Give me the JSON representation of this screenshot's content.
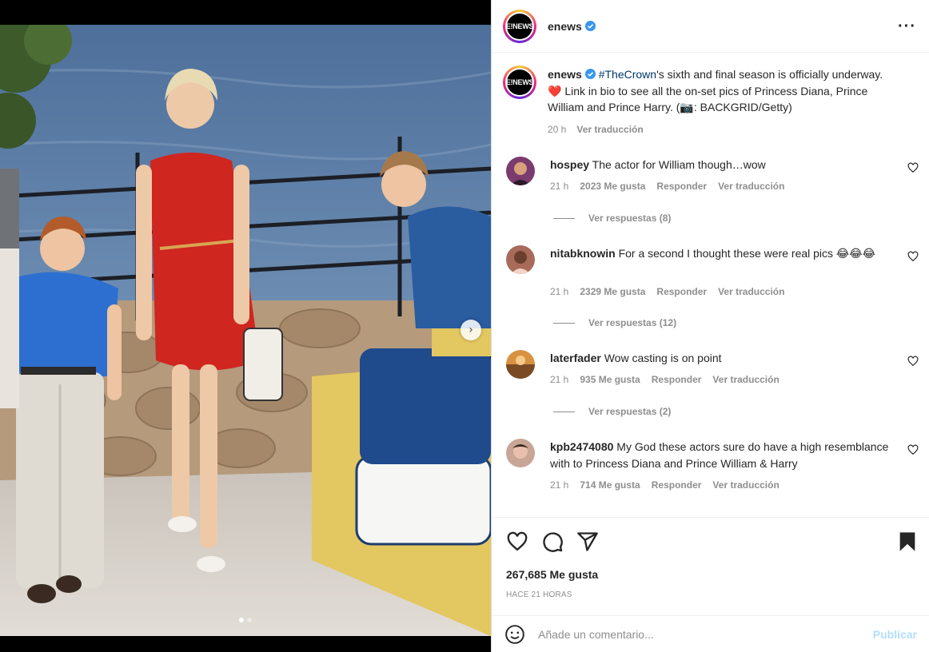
{
  "post": {
    "account": "enews",
    "avatar_text": "E!NEWS",
    "caption_hashtag": "#TheCrown",
    "caption_text": "'s sixth and final season is officially underway. ❤️ Link in bio to see all the on-set pics of Princess Diana, Prince William and Prince Harry. (📷: BACKGRID/Getty)",
    "caption_time": "20 h",
    "caption_translate": "Ver traducción",
    "more_icon": "more-horizontal-icon"
  },
  "comments": [
    {
      "user": "hospey",
      "text": "The actor for William though…wow",
      "time": "21 h",
      "likes": "2023 Me gusta",
      "reply": "Responder",
      "translate": "Ver traducción",
      "replies": "Ver respuestas (8)"
    },
    {
      "user": "nitabknowin",
      "text": "For a second I thought these were real pics 😂😂😂",
      "time": "21 h",
      "likes": "2329 Me gusta",
      "reply": "Responder",
      "translate": "Ver traducción",
      "replies": "Ver respuestas (12)"
    },
    {
      "user": "laterfader",
      "text": "Wow casting is on point",
      "time": "21 h",
      "likes": "935 Me gusta",
      "reply": "Responder",
      "translate": "Ver traducción",
      "replies": "Ver respuestas (2)"
    },
    {
      "user": "kpb2474080",
      "text": "My God these actors sure do have a high resemblance with to Princess Diana and Prince William & Harry",
      "time": "21 h",
      "likes": "714 Me gusta",
      "reply": "Responder",
      "translate": "Ver traducción"
    }
  ],
  "actions": {
    "like_icon": "heart-icon",
    "comment_icon": "comment-icon",
    "share_icon": "share-icon",
    "save_icon": "bookmark-icon",
    "likes_count": "267,685 Me gusta",
    "posted": "HACE 21 HORAS"
  },
  "add_comment": {
    "placeholder": "Añade un comentario...",
    "publish": "Publicar",
    "emoji_icon": "emoji-icon"
  },
  "carousel": {
    "slide_count": 2,
    "active_index": 0,
    "next_icon": "chevron-right-icon"
  },
  "colors": {
    "link": "#00376b",
    "verified": "#3897f0",
    "publish_disabled": "#b2dffc",
    "secondary_text": "#8e8e8e"
  }
}
